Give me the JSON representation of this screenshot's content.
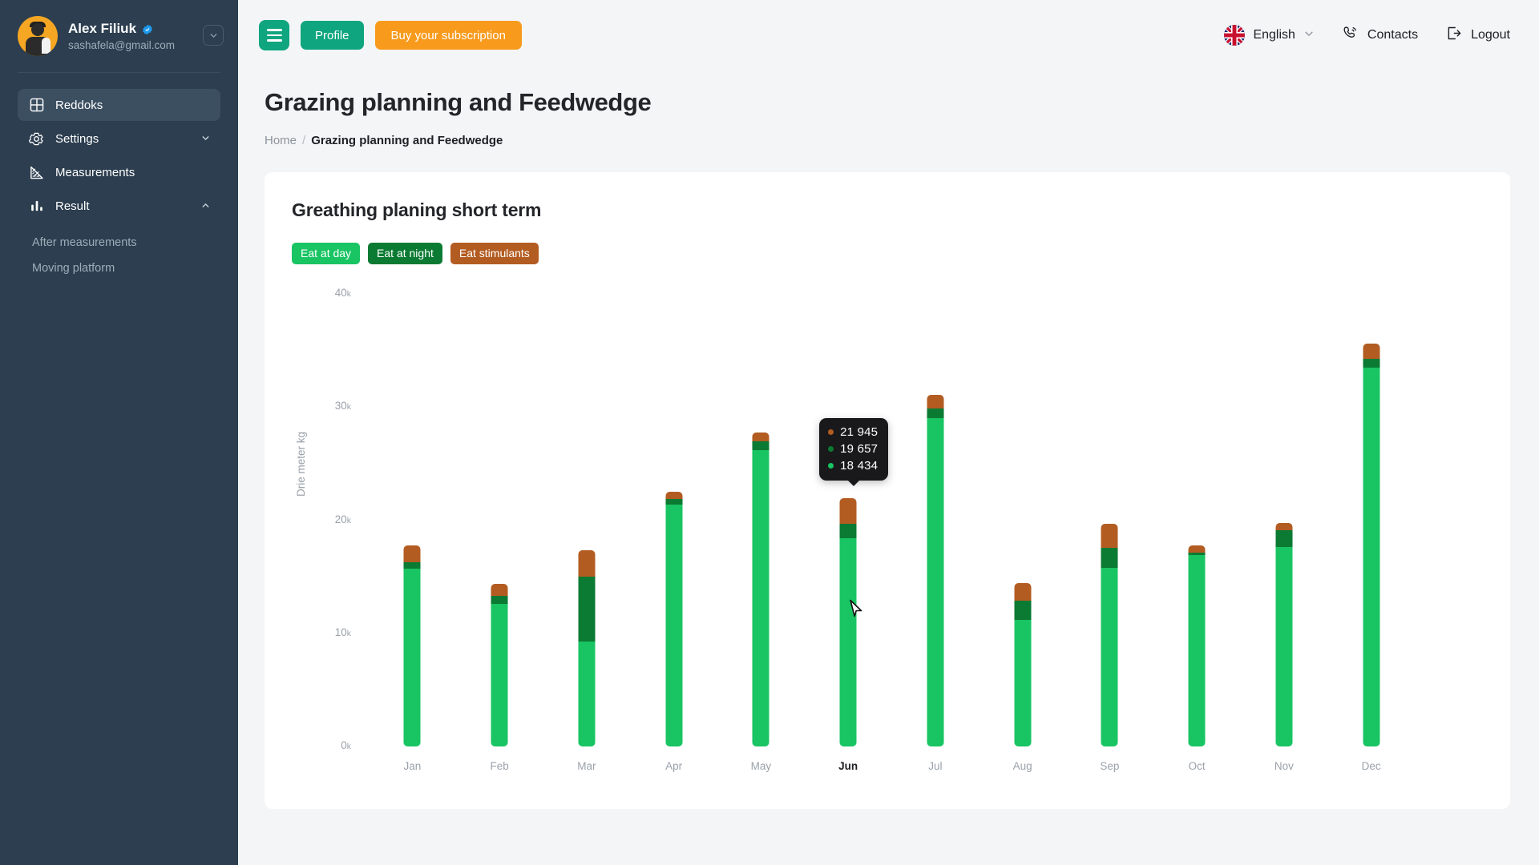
{
  "sidebar": {
    "profile": {
      "name": "Alex Filiuk",
      "email": "sashafela@gmail.com",
      "verified_icon": "verified-badge-icon",
      "avatar_icon": "user-avatar",
      "caret_icon": "chevron-down-icon"
    },
    "items": [
      {
        "label": "Reddoks",
        "icon": "grid-icon",
        "active": true,
        "expandable": false
      },
      {
        "label": "Settings",
        "icon": "gear-icon",
        "active": false,
        "expandable": true,
        "expanded": false
      },
      {
        "label": "Measurements",
        "icon": "ruler-icon",
        "active": false,
        "expandable": false
      },
      {
        "label": "Result",
        "icon": "bar-chart-icon",
        "active": false,
        "expandable": true,
        "expanded": true
      }
    ],
    "subitems": [
      {
        "label": "After measurements"
      },
      {
        "label": "Moving platform"
      }
    ]
  },
  "topbar": {
    "menu_icon": "hamburger-menu-icon",
    "profile_label": "Profile",
    "subscription_label": "Buy your subscription",
    "language": "English",
    "language_flag": "uk-flag-icon",
    "language_caret_icon": "chevron-down-icon",
    "contacts_label": "Contacts",
    "contacts_icon": "phone-icon",
    "logout_label": "Logout",
    "logout_icon": "logout-icon"
  },
  "page": {
    "title": "Grazing planning and Feedwedge",
    "breadcrumb": {
      "home": "Home",
      "separator": "/",
      "current": "Grazing planning and Feedwedge"
    }
  },
  "card": {
    "title": "Greathing planing short term",
    "legend": [
      {
        "label": "Eat at day",
        "color": "#19c463"
      },
      {
        "label": "Eat at night",
        "color": "#0b7a33"
      },
      {
        "label": "Eat stimulants",
        "color": "#b35c22"
      }
    ]
  },
  "tooltip": {
    "category": "Jun",
    "rows": [
      {
        "value": "21 945",
        "color": "#b35c22"
      },
      {
        "value": "19 657",
        "color": "#0b7a33"
      },
      {
        "value": "18 434",
        "color": "#19c463"
      }
    ]
  },
  "colors": {
    "accent_green": "#0fa57f",
    "accent_orange": "#f89a1c",
    "sidebar_bg": "#2c3e4f",
    "bar_day": "#19c463",
    "bar_night": "#0b7a33",
    "bar_stimulants": "#b35c22"
  },
  "chart_data": {
    "type": "bar",
    "stacked": true,
    "title": "Greathing planing short term",
    "xlabel": "",
    "ylabel": "Drie meter kg",
    "ylim": [
      0,
      40000
    ],
    "yticks": [
      "0k",
      "10k",
      "20k",
      "30k",
      "40k"
    ],
    "ytick_values": [
      0,
      10000,
      20000,
      30000,
      40000
    ],
    "grid": false,
    "legend_position": "top-left",
    "categories": [
      "Jan",
      "Feb",
      "Mar",
      "Apr",
      "May",
      "Jun",
      "Jul",
      "Aug",
      "Sep",
      "Oct",
      "Nov",
      "Dec"
    ],
    "highlighted_category": "Jun",
    "series": [
      {
        "name": "Eat at day",
        "color": "#19c463",
        "values": [
          15700,
          12600,
          9300,
          21400,
          26200,
          18434,
          29000,
          11200,
          15800,
          16900,
          17600,
          33500
        ]
      },
      {
        "name": "Eat at night",
        "color": "#0b7a33",
        "values": [
          620,
          690,
          5700,
          500,
          760,
          1223,
          900,
          1700,
          1750,
          260,
          1500,
          780
        ]
      },
      {
        "name": "Eat stimulants",
        "color": "#b35c22",
        "values": [
          1440,
          1100,
          2350,
          600,
          760,
          2288,
          1190,
          1560,
          2150,
          620,
          680,
          1330
        ]
      }
    ],
    "totals": [
      17760,
      14390,
      17350,
      22500,
      27720,
      21945,
      31090,
      14460,
      19700,
      17780,
      19780,
      35610
    ]
  }
}
